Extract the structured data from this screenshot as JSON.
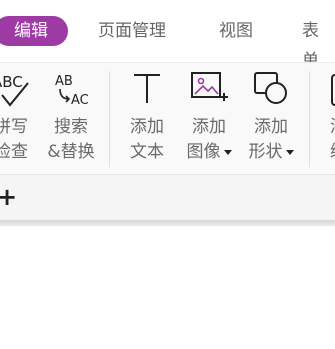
{
  "tabs": [
    {
      "label": "编辑",
      "active": true
    },
    {
      "label": "页面管理",
      "active": false
    },
    {
      "label": "视图",
      "active": false
    },
    {
      "label": "表单",
      "active": false
    }
  ],
  "tools": [
    {
      "id": "spell",
      "line1": "拼写",
      "line2": "检查",
      "icon": "spellcheck-icon"
    },
    {
      "id": "search",
      "line1": "搜索",
      "line2": "&替换",
      "icon": "search-replace-icon"
    },
    {
      "id": "text",
      "line1": "添加",
      "line2": "文本",
      "icon": "text-icon"
    },
    {
      "id": "image",
      "line1": "添加",
      "line2": "图像",
      "icon": "add-image-icon",
      "dropdown": true
    },
    {
      "id": "shape",
      "line1": "添加",
      "line2": "形状",
      "icon": "add-shape-icon",
      "dropdown": true
    },
    {
      "id": "more",
      "line1": "添",
      "line2": "编",
      "icon": "more-icon"
    }
  ],
  "icon_text": {
    "abc": "ABC",
    "ab": "AB",
    "ac": "AC"
  },
  "add_tab_symbol": "+",
  "colors": {
    "accent": "#9e3aa4",
    "tab_text": "#666666",
    "tool_label": "#6a6a6a"
  }
}
